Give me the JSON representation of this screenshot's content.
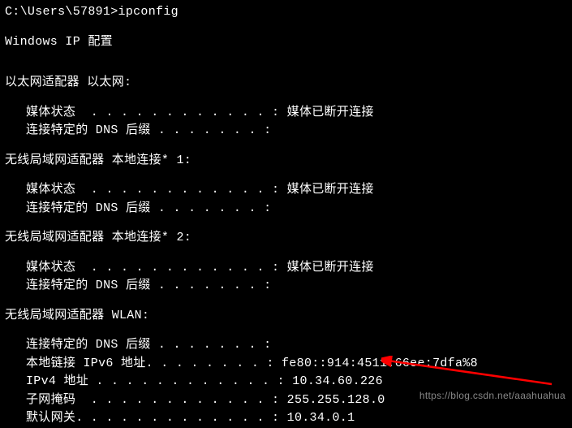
{
  "prompt": "C:\\Users\\57891>ipconfig",
  "header": "Windows IP 配置",
  "adapters": [
    {
      "title": "以太网适配器 以太网:",
      "lines": [
        {
          "label": "媒体状态",
          "dots": "  . . . . . . . . . . . . : ",
          "value": "媒体已断开连接"
        },
        {
          "label": "连接特定的 DNS 后缀",
          "dots": " . . . . . . . :",
          "value": ""
        }
      ]
    },
    {
      "title": "无线局域网适配器 本地连接* 1:",
      "lines": [
        {
          "label": "媒体状态",
          "dots": "  . . . . . . . . . . . . : ",
          "value": "媒体已断开连接"
        },
        {
          "label": "连接特定的 DNS 后缀",
          "dots": " . . . . . . . :",
          "value": ""
        }
      ]
    },
    {
      "title": "无线局域网适配器 本地连接* 2:",
      "lines": [
        {
          "label": "媒体状态",
          "dots": "  . . . . . . . . . . . . : ",
          "value": "媒体已断开连接"
        },
        {
          "label": "连接特定的 DNS 后缀",
          "dots": " . . . . . . . :",
          "value": ""
        }
      ]
    },
    {
      "title": "无线局域网适配器 WLAN:",
      "lines": [
        {
          "label": "连接特定的 DNS 后缀",
          "dots": " . . . . . . . :",
          "value": ""
        },
        {
          "label": "本地链接 IPv6 地址",
          "dots": ". . . . . . . . : ",
          "value": "fe80::914:4511:66ee:7dfa%8"
        },
        {
          "label": "IPv4 地址",
          "dots": " . . . . . . . . . . . . : ",
          "value": "10.34.60.226"
        },
        {
          "label": "子网掩码",
          "dots": "  . . . . . . . . . . . . : ",
          "value": "255.255.128.0"
        },
        {
          "label": "默认网关",
          "dots": ". . . . . . . . . . . . . : ",
          "value": "10.34.0.1"
        }
      ]
    }
  ],
  "watermark": "https://blog.csdn.net/aaahuahua"
}
